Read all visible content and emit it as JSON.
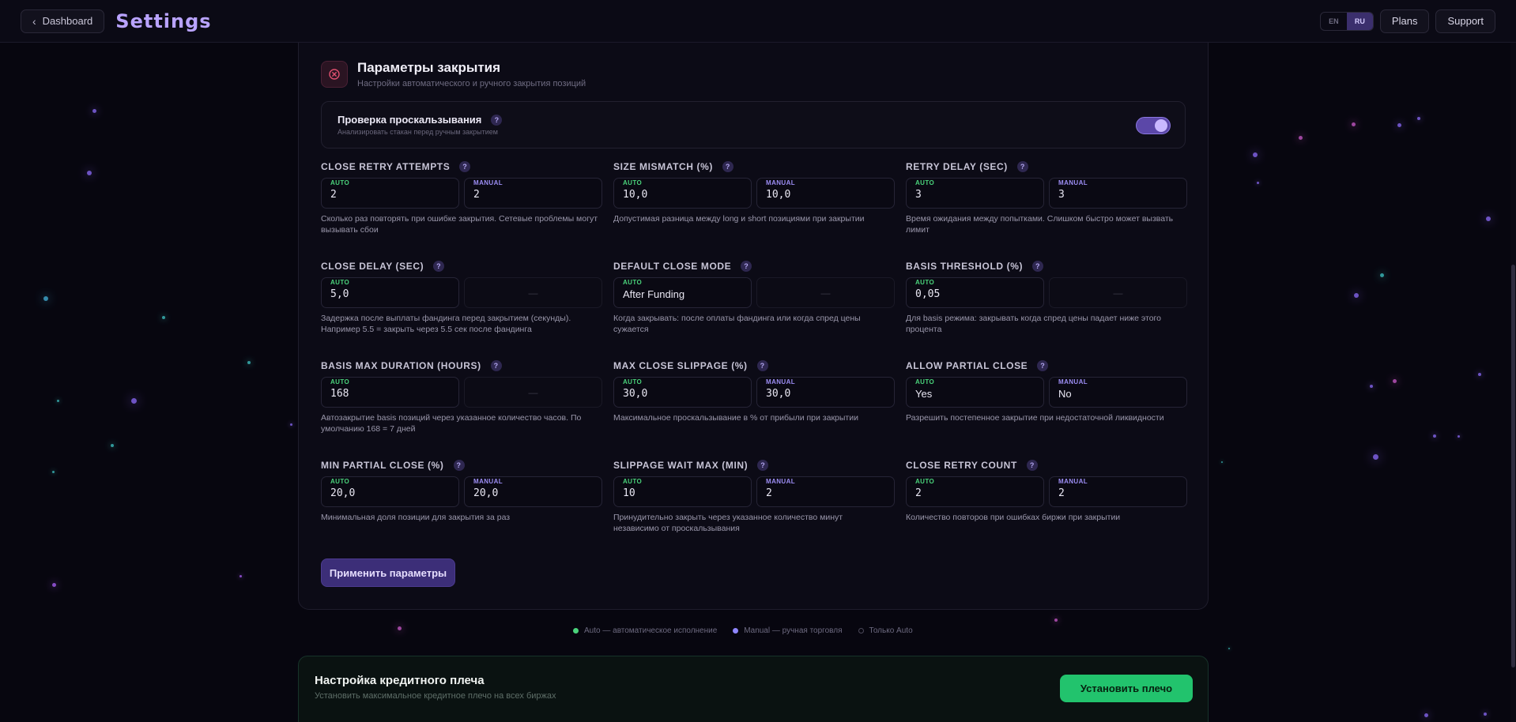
{
  "header": {
    "back_label": "Dashboard",
    "title": "Settings",
    "lang_en": "EN",
    "lang_ru": "RU",
    "plans_label": "Plans",
    "support_label": "Support"
  },
  "section": {
    "title": "Параметры закрытия",
    "subtitle": "Настройки автоматического и ручного закрытия позиций",
    "help_glyph": "?"
  },
  "slippage_check": {
    "label": "Проверка проскальзывания",
    "description": "Анализировать стакан перед ручным закрытием",
    "enabled": true
  },
  "tags": {
    "auto": "AUTO",
    "manual": "MANUAL",
    "empty": "—"
  },
  "fields": [
    {
      "label": "CLOSE RETRY ATTEMPTS",
      "auto": "2",
      "manual": "2",
      "description": "Сколько раз повторять при ошибке закрытия. Сетевые проблемы могут вызывать сбои"
    },
    {
      "label": "SIZE MISMATCH (%)",
      "auto": "10,0",
      "manual": "10,0",
      "description": "Допустимая разница между long и short позициями при закрытии"
    },
    {
      "label": "RETRY DELAY (SEC)",
      "auto": "3",
      "manual": "3",
      "description": "Время ожидания между попытками. Слишком быстро может вызвать лимит"
    },
    {
      "label": "CLOSE DELAY (SEC)",
      "auto": "5,0",
      "manual": "—",
      "description": "Задержка после выплаты фандинга перед закрытием (секунды). Например 5.5 = закрыть через 5.5 сек после фандинга"
    },
    {
      "label": "DEFAULT CLOSE MODE",
      "auto": "After Funding",
      "manual": "—",
      "description": "Когда закрывать: после оплаты фандинга или когда спред цены сужается"
    },
    {
      "label": "BASIS THRESHOLD (%)",
      "auto": "0,05",
      "manual": "—",
      "description": "Для basis режима: закрывать когда спред цены падает ниже этого процента"
    },
    {
      "label": "BASIS MAX DURATION (HOURS)",
      "auto": "168",
      "manual": "—",
      "description": "Автозакрытие basis позиций через указанное количество часов. По умолчанию 168 = 7 дней"
    },
    {
      "label": "MAX CLOSE SLIPPAGE (%)",
      "auto": "30,0",
      "manual": "30,0",
      "description": "Максимальное проскальзывание в % от прибыли при закрытии"
    },
    {
      "label": "ALLOW PARTIAL CLOSE",
      "auto": "Yes",
      "manual": "No",
      "description": "Разрешить постепенное закрытие при недостаточной ликвидности"
    },
    {
      "label": "MIN PARTIAL CLOSE (%)",
      "auto": "20,0",
      "manual": "20,0",
      "description": "Минимальная доля позиции для закрытия за раз"
    },
    {
      "label": "SLIPPAGE WAIT MAX (MIN)",
      "auto": "10",
      "manual": "2",
      "description": "Принудительно закрыть через указанное количество минут независимо от проскальзывания"
    },
    {
      "label": "CLOSE RETRY COUNT",
      "auto": "2",
      "manual": "2",
      "description": "Количество повторов при ошибках биржи при закрытии"
    }
  ],
  "apply_label": "Применить параметры",
  "legend": {
    "auto": "Auto — автоматическое исполнение",
    "manual": "Manual — ручная торговля",
    "auto_only": "Только Auto"
  },
  "leverage": {
    "title": "Настройка кредитного плеча",
    "subtitle": "Установить максимальное кредитное плечо на всех биржах",
    "button_label": "Установить плечо"
  },
  "colors": {
    "accent": "#b9a3ff",
    "auto_tag": "#4ad37b",
    "manual_tag": "#9d8ef5",
    "apply_button": "#3c2e78",
    "leverage_button": "#22c36d"
  }
}
